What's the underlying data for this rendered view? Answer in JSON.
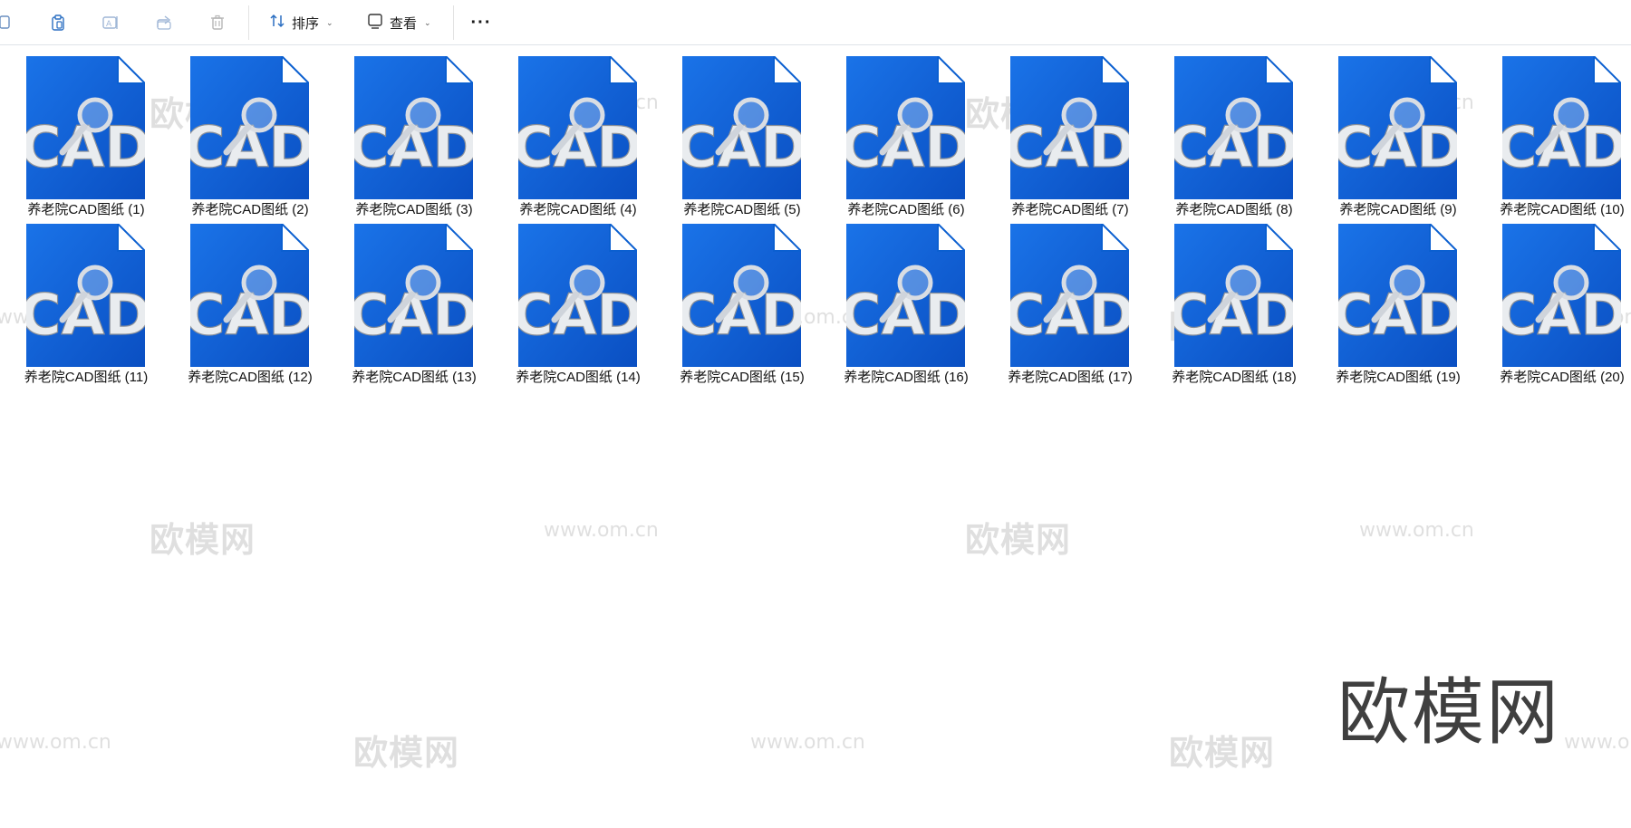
{
  "toolbar": {
    "sort_label": "排序",
    "view_label": "查看",
    "more_label": "···"
  },
  "files": [
    {
      "name": "养老院CAD图纸 (1)"
    },
    {
      "name": "养老院CAD图纸 (2)"
    },
    {
      "name": "养老院CAD图纸 (3)"
    },
    {
      "name": "养老院CAD图纸 (4)"
    },
    {
      "name": "养老院CAD图纸 (5)"
    },
    {
      "name": "养老院CAD图纸 (6)"
    },
    {
      "name": "养老院CAD图纸 (7)"
    },
    {
      "name": "养老院CAD图纸 (8)"
    },
    {
      "name": "养老院CAD图纸 (9)"
    },
    {
      "name": "养老院CAD图纸 (10)"
    },
    {
      "name": "养老院CAD图纸 (11)"
    },
    {
      "name": "养老院CAD图纸 (12)"
    },
    {
      "name": "养老院CAD图纸 (13)"
    },
    {
      "name": "养老院CAD图纸 (14)"
    },
    {
      "name": "养老院CAD图纸 (15)"
    },
    {
      "name": "养老院CAD图纸 (16)"
    },
    {
      "name": "养老院CAD图纸 (17)"
    },
    {
      "name": "养老院CAD图纸 (18)"
    },
    {
      "name": "养老院CAD图纸 (19)"
    },
    {
      "name": "养老院CAD图纸 (20)"
    }
  ],
  "file_icon_text": "CAD",
  "watermark": {
    "cn": "欧模网",
    "url": "www.om.cn",
    "big": "欧模网"
  },
  "colors": {
    "icon_blue": "#1a73e8",
    "icon_blue_dark": "#0a4fc2",
    "accent": "#0067c0"
  }
}
